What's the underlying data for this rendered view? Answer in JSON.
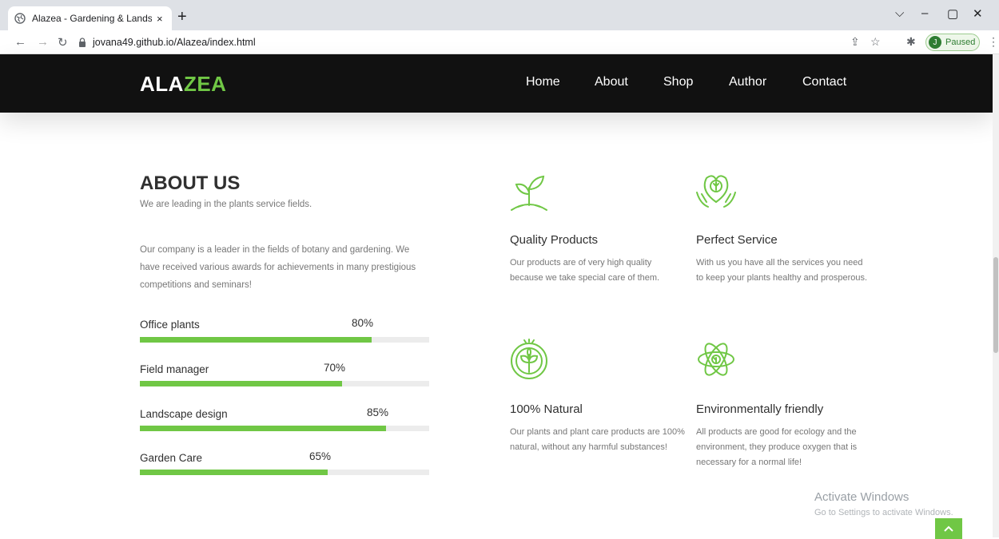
{
  "browser": {
    "tab_title": "Alazea - Gardening & Landscapi",
    "tab_close": "×",
    "new_tab": "+",
    "url": "jovana49.github.io/Alazea/index.html",
    "profile_initial": "J",
    "profile_status": "Paused"
  },
  "header": {
    "logo_part1": "ALA",
    "logo_part2": "ZEA",
    "nav": [
      "Home",
      "About",
      "Shop",
      "Author",
      "Contact"
    ]
  },
  "about": {
    "title": "ABOUT US",
    "subtitle": "We are leading in the plants service fields.",
    "text": "Our company is a leader in the fields of botany and gardening. We have received various awards for achievements in many prestigious competitions and seminars!",
    "skills": [
      {
        "label": "Office plants",
        "percent_text": "80%",
        "value": 80
      },
      {
        "label": "Field manager",
        "percent_text": "70%",
        "value": 70
      },
      {
        "label": "Landscape design",
        "percent_text": "85%",
        "value": 85
      },
      {
        "label": "Garden Care",
        "percent_text": "65%",
        "value": 65
      }
    ]
  },
  "features": [
    {
      "icon": "sprout-icon",
      "title": "Quality Products",
      "text": "Our products are of very high quality because we take special care of them."
    },
    {
      "icon": "heart-hands-icon",
      "title": "Perfect Service",
      "text": "With us you have all the services you need to keep your plants healthy and prosperous."
    },
    {
      "icon": "leaf-badge-icon",
      "title": "100% Natural",
      "text": "Our plants and plant care products are 100% natural, without any harmful substances!"
    },
    {
      "icon": "eco-atom-icon",
      "title": "Environmentally friendly",
      "text": "All products are good for ecology and the environment, they produce oxygen that is necessary for a normal life!"
    }
  ],
  "watermark": {
    "title": "Activate Windows",
    "subtitle": "Go to Settings to activate Windows."
  },
  "accent_color": "#70c745"
}
